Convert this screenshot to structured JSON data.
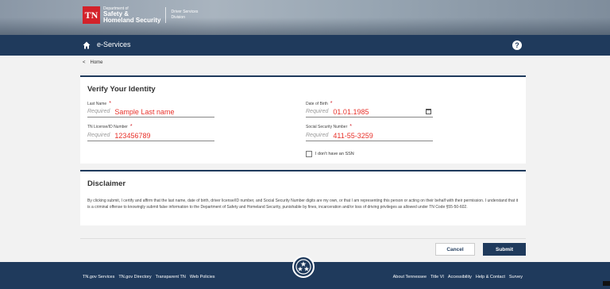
{
  "header": {
    "logo_mark": "TN",
    "dept_line1": "Department of",
    "dept_line2": "Safety &",
    "dept_line3": "Homeland Security",
    "division_line1": "Driver Services",
    "division_line2": "Division"
  },
  "nav": {
    "title": "e-Services",
    "help": "?"
  },
  "breadcrumb": {
    "back": "<",
    "home": "Home"
  },
  "verify": {
    "title": "Verify Your Identity",
    "last_name": {
      "label": "Last Name",
      "placeholder": "Required",
      "value": "Sample Last name"
    },
    "dob": {
      "label": "Date of Birth",
      "placeholder": "Required",
      "value": "01.01.1985"
    },
    "license": {
      "label": "TN License/ID Number",
      "placeholder": "Required",
      "value": "123456789"
    },
    "ssn": {
      "label": "Social Security Number",
      "placeholder": "Required",
      "value": "411-55-3259"
    },
    "no_ssn_label": "I don't have an SSN",
    "required_mark": "*"
  },
  "disclaimer": {
    "title": "Disclaimer",
    "text": "By clicking submit, I certify and affirm that the last name, date of birth, driver license/ID number, and Social Security Number digits are my own, or that I am representing this person or acting on their behalf with their permission. I understand that it is a criminal offense to knowingly submit false information to the Department of Safety and Homeland Security, punishable by fines, incarceration and/or loss of driving privileges as allowed under TN Code §55-50-602."
  },
  "actions": {
    "cancel": "Cancel",
    "submit": "Submit"
  },
  "footer": {
    "left_links": [
      "TN.gov Services",
      "TN.gov Directory",
      "Transparent TN",
      "Web Policies"
    ],
    "right_links": [
      "About Tennessee",
      "Title VI",
      "Accessibility",
      "Help & Contact",
      "Survey"
    ]
  },
  "colors": {
    "navy": "#1f3a5c",
    "brand_red": "#d3222a",
    "value_red": "#e8312a"
  },
  "icons": [
    "home-icon",
    "help-icon",
    "calendar-icon",
    "tn-seal-icon",
    "back-chevron-icon"
  ]
}
